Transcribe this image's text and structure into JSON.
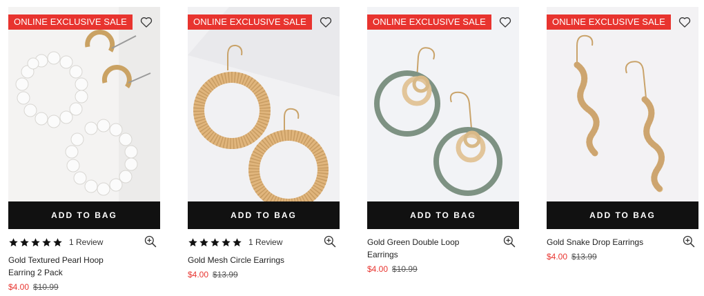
{
  "products": [
    {
      "badge": "ONLINE EXCLUSIVE SALE",
      "button": "ADD TO BAG",
      "rating": 5,
      "reviews": "1 Review",
      "title": "Gold Textured Pearl Hoop Earring 2 Pack",
      "price_now": "$4.00",
      "price_was": "$10.99"
    },
    {
      "badge": "ONLINE EXCLUSIVE SALE",
      "button": "ADD TO BAG",
      "rating": 5,
      "reviews": "1 Review",
      "title": "Gold Mesh Circle Earrings",
      "price_now": "$4.00",
      "price_was": "$13.99"
    },
    {
      "badge": "ONLINE EXCLUSIVE SALE",
      "button": "ADD TO BAG",
      "title": "Gold Green Double Loop Earrings",
      "price_now": "$4.00",
      "price_was": "$10.99"
    },
    {
      "badge": "ONLINE EXCLUSIVE SALE",
      "button": "ADD TO BAG",
      "title": "Gold Snake Drop Earrings",
      "price_now": "$4.00",
      "price_was": "$13.99"
    }
  ],
  "icons": {
    "wishlist": "heart-icon",
    "quick_view": "zoom-in-icon",
    "rating": "star-icon"
  },
  "colors": {
    "sale_badge": "#e8342f",
    "button_bg": "#111111",
    "sale_price": "#e8342f",
    "gold": "#d9b47a",
    "sage_green": "#7e9283"
  }
}
